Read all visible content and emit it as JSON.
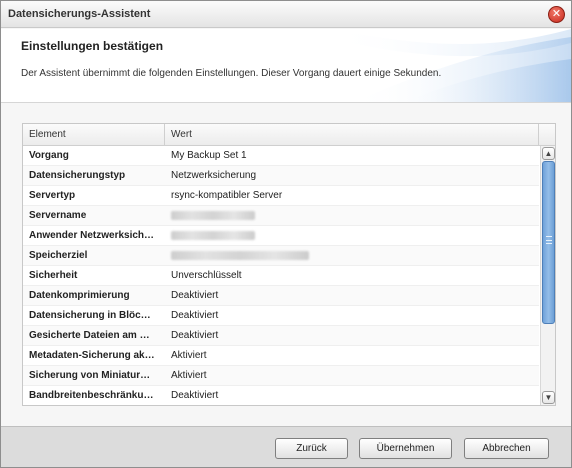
{
  "window": {
    "title": "Datensicherungs-Assistent",
    "close_glyph": "✕",
    "close_icon": "close-icon"
  },
  "header": {
    "title": "Einstellungen bestätigen",
    "description": "Der Assistent übernimmt die folgenden Einstellungen. Dieser Vorgang dauert einige Sekunden."
  },
  "grid": {
    "columns": [
      "Element",
      "Wert"
    ],
    "rows": [
      {
        "element": "Vorgang",
        "value": "My Backup Set 1"
      },
      {
        "element": "Datensicherungstyp",
        "value": "Netzwerksicherung"
      },
      {
        "element": "Servertyp",
        "value": "rsync-kompatibler Server"
      },
      {
        "element": "Servername",
        "value": ""
      },
      {
        "element": "Anwender Netzwerksich…",
        "value": ""
      },
      {
        "element": "Speicherziel",
        "value": ""
      },
      {
        "element": "Sicherheit",
        "value": "Unverschlüsselt"
      },
      {
        "element": "Datenkomprimierung",
        "value": "Deaktiviert"
      },
      {
        "element": "Datensicherung in Blöc…",
        "value": "Deaktiviert"
      },
      {
        "element": "Gesicherte Dateien am …",
        "value": "Deaktiviert"
      },
      {
        "element": "Metadaten-Sicherung ak…",
        "value": "Aktiviert"
      },
      {
        "element": "Sicherung von Miniatur…",
        "value": "Aktiviert"
      },
      {
        "element": "Bandbreitenbeschränku…",
        "value": "Deaktiviert"
      }
    ],
    "scroll_up_glyph": "▲",
    "scroll_down_glyph": "▼"
  },
  "buttons": {
    "back": "Zurück",
    "apply": "Übernehmen",
    "cancel": "Abbrechen"
  },
  "colors": {
    "accent": "#6fa2da",
    "close": "#c8261a"
  }
}
